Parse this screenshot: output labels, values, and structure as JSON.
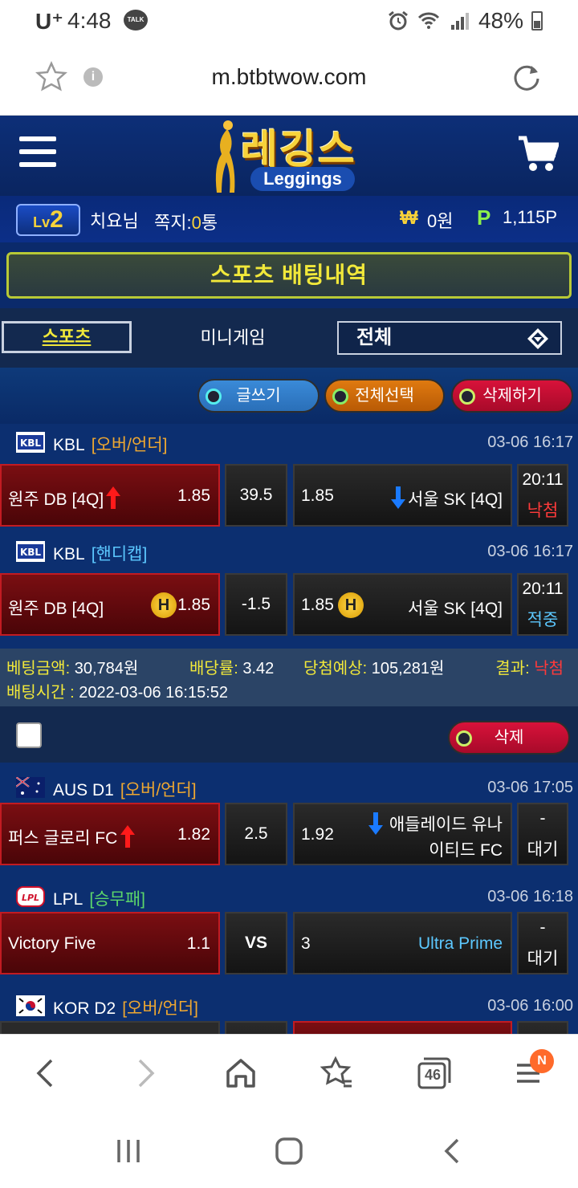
{
  "status": {
    "carrier": "U⁺",
    "time": "4:48",
    "talk_icon": "TALK",
    "battery": "48%"
  },
  "browser": {
    "url": "m.btbtwow.com",
    "tabs_count": "46",
    "menu_badge": "N"
  },
  "site": {
    "logo_korean": "레깅스",
    "logo_english": "Leggings",
    "user": {
      "level_prefix": "Lv",
      "level": "2",
      "name": "치요님",
      "memo_label": "쪽지:",
      "memo_count": "0",
      "memo_unit": "통",
      "won_symbol": "₩",
      "won_value": "0원",
      "point_symbol": "P",
      "point_value": "1,115P"
    },
    "page_title": "스포츠 배팅내역",
    "tabs": {
      "sports": "스포츠",
      "minigame": "미니게임",
      "filter_selected": "전체"
    },
    "actions": {
      "write": "글쓰기",
      "select_all": "전체선택",
      "delete": "삭제하기"
    }
  },
  "bet_slip_1": {
    "rows": [
      {
        "league": "KBL",
        "type": "[오버/언더]",
        "datetime": "03-06 16:17",
        "home": "원주 DB [4Q]",
        "home_odds": "1.85",
        "line": "39.5",
        "away_odds": "1.85",
        "away": "서울 SK [4Q]",
        "result_time": "20:11",
        "result": "낙첨"
      },
      {
        "league": "KBL",
        "type": "[핸디캡]",
        "datetime": "03-06 16:17",
        "home": "원주 DB [4Q]",
        "home_badge": "H",
        "home_odds": "1.85",
        "line": "-1.5",
        "away_odds": "1.85",
        "away_badge": "H",
        "away": "서울 SK [4Q]",
        "result_time": "20:11",
        "result": "적중"
      }
    ],
    "summary": {
      "amount_label": "베팅금액:",
      "amount": "30,784원",
      "rate_label": "배당률:",
      "rate": "3.42",
      "expected_label": "당첨예상:",
      "expected": "105,281원",
      "result_label": "결과:",
      "result": "낙첨",
      "time_label": "배팅시간 :",
      "time": "2022-03-06 16:15:52"
    }
  },
  "bet_slip_2": {
    "delete_label": "삭제",
    "rows": [
      {
        "league": "AUS D1",
        "type": "[오버/언더]",
        "datetime": "03-06 17:05",
        "home": "퍼스 글로리 FC",
        "home_odds": "1.82",
        "line": "2.5",
        "away_odds": "1.92",
        "away_line1": "애들레이드 유나",
        "away_line2": "이티드 FC",
        "result_time": "-",
        "result": "대기"
      },
      {
        "league": "LPL",
        "type": "[승무패]",
        "datetime": "03-06 16:18",
        "home": "Victory Five",
        "home_odds": "1.1",
        "line": "VS",
        "away_odds": "3",
        "away": "Ultra Prime",
        "result_time": "-",
        "result": "대기"
      },
      {
        "league": "KOR D2",
        "type": "[오버/언더]",
        "datetime": "03-06 16:00"
      }
    ]
  },
  "colors": {
    "site_bg": "#0b2a6b",
    "accent_yellow": "#f1e83a",
    "lose_red": "#ff3a3a",
    "win_blue": "#5cc8ff"
  }
}
